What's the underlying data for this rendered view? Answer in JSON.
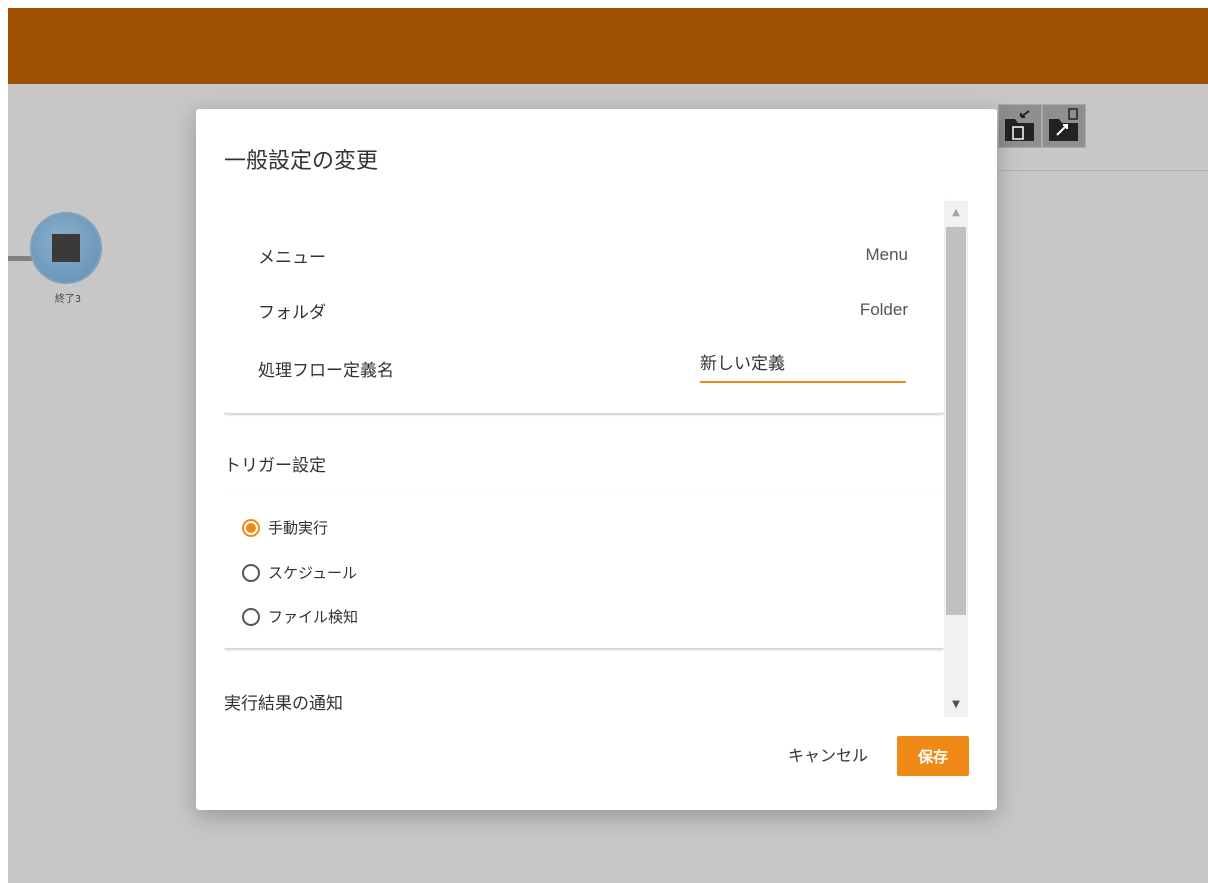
{
  "colors": {
    "topbar": "#a05203",
    "accent": "#ef8a16",
    "backdrop": "#c7c7c7"
  },
  "canvas": {
    "node_label": "終了3",
    "node_icon": "stop-square-icon",
    "toolbar_icons": [
      "import-folder-icon",
      "export-folder-icon"
    ]
  },
  "dialog": {
    "title": "一般設定の変更",
    "general": {
      "menu_label": "メニュー",
      "menu_value": "Menu",
      "folder_label": "フォルダ",
      "folder_value": "Folder",
      "flow_name_label": "処理フロー定義名",
      "flow_name_value": "新しい定義"
    },
    "trigger": {
      "title": "トリガー設定",
      "options": [
        "手動実行",
        "スケジュール",
        "ファイル検知"
      ],
      "selected": "手動実行"
    },
    "notification": {
      "title": "実行結果の通知"
    },
    "scrollbar_icons": [
      "scroll-up-arrow-icon",
      "scroll-down-arrow-icon"
    ],
    "buttons": {
      "cancel": "キャンセル",
      "save": "保存"
    }
  }
}
